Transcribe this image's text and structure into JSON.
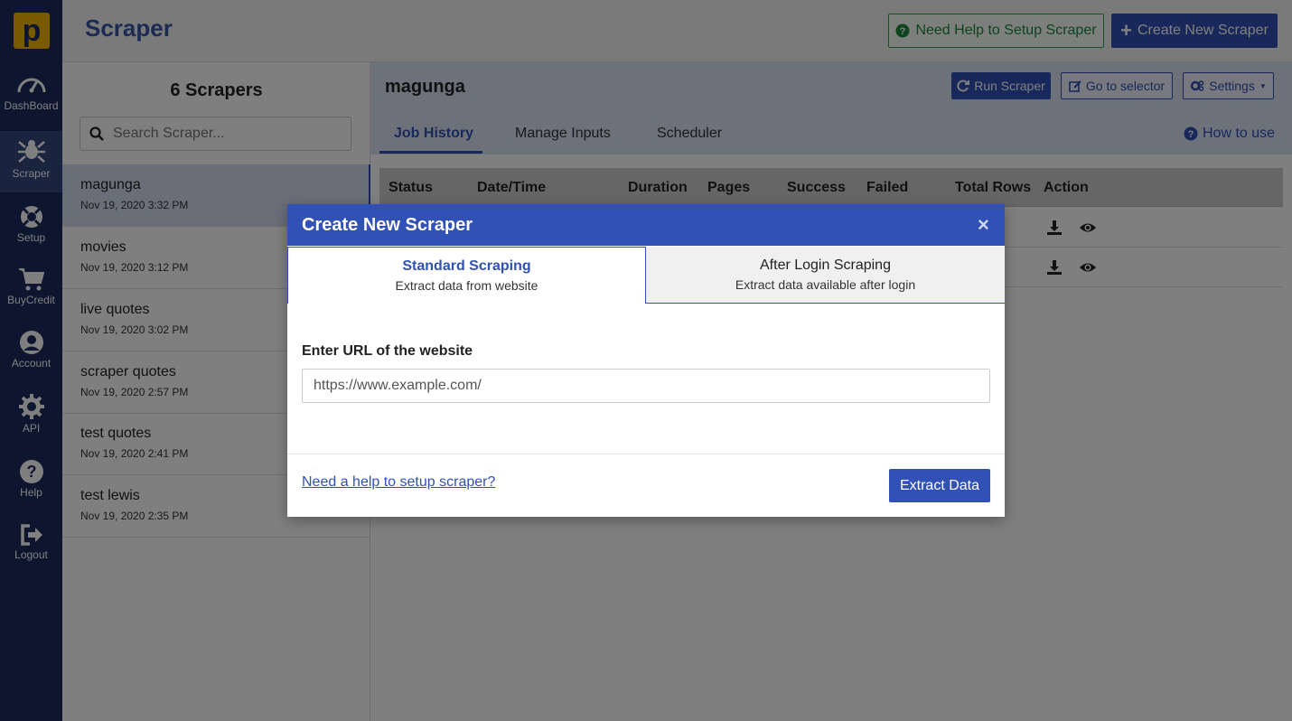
{
  "app": {
    "logo_letter": "p",
    "title": "Scraper"
  },
  "nav": [
    {
      "label": "DashBoard",
      "icon": "dashboard-icon"
    },
    {
      "label": "Scraper",
      "icon": "spider-icon",
      "active": true
    },
    {
      "label": "Setup",
      "icon": "lifebuoy-icon"
    },
    {
      "label": "BuyCredit",
      "icon": "cart-icon"
    },
    {
      "label": "Account",
      "icon": "user-circle-icon"
    },
    {
      "label": "API",
      "icon": "api-gear-icon"
    },
    {
      "label": "Help",
      "icon": "question-circle-icon"
    },
    {
      "label": "Logout",
      "icon": "logout-icon"
    }
  ],
  "header": {
    "help_button": "Need Help to Setup Scraper",
    "create_button": "Create New Scraper"
  },
  "sidebar": {
    "count_title": "6 Scrapers",
    "search_placeholder": "Search Scraper...",
    "items": [
      {
        "name": "magunga",
        "date": "Nov 19, 2020 3:32 PM"
      },
      {
        "name": "movies",
        "date": "Nov 19, 2020 3:12 PM"
      },
      {
        "name": "live quotes",
        "date": "Nov 19, 2020 3:02 PM"
      },
      {
        "name": "scraper quotes",
        "date": "Nov 19, 2020 2:57 PM"
      },
      {
        "name": "test quotes",
        "date": "Nov 19, 2020 2:41 PM"
      },
      {
        "name": "test lewis",
        "date": "Nov 19, 2020 2:35 PM"
      }
    ]
  },
  "main": {
    "scraper_name": "magunga",
    "run_button": "Run Scraper",
    "go_selector_button": "Go to selector",
    "settings_button": "Settings",
    "tabs": [
      "Job History",
      "Manage Inputs",
      "Scheduler"
    ],
    "how_to_use": "How to use",
    "table_headers": [
      "Status",
      "Date/Time",
      "Duration",
      "Pages",
      "Success",
      "Failed",
      "Total Rows",
      "Action"
    ]
  },
  "modal": {
    "title": "Create New Scraper",
    "close": "×",
    "tab_standard_title": "Standard Scraping",
    "tab_standard_sub": "Extract data from website",
    "tab_after_title": "After Login Scraping",
    "tab_after_sub": "Extract data available after login",
    "url_label": "Enter URL of the website",
    "url_placeholder": "https://www.example.com/",
    "help_link": "Need a help to setup scraper?",
    "extract_button": "Extract Data"
  },
  "colors": {
    "brand": "#3151b7",
    "nav_bg": "#1a2b5e",
    "logo": "#f0b400",
    "help_green": "#28a745"
  }
}
